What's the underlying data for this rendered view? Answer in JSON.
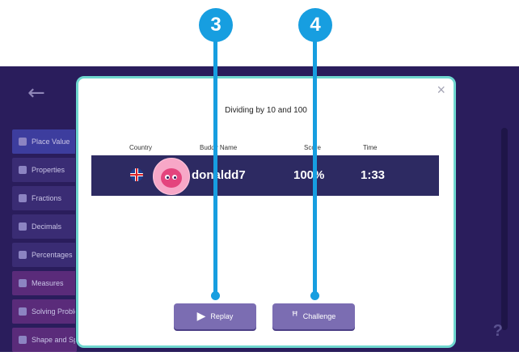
{
  "modal": {
    "title": "Dividing by 10 and 100",
    "close_glyph": "×",
    "columns": {
      "country": "Country",
      "buddy": "Buddy Name",
      "score": "Score",
      "time": "Time"
    },
    "row": {
      "country_icon": "uk-flag-icon",
      "buddy_name": "donaldd7",
      "score": "100%",
      "time": "1:33"
    },
    "buttons": {
      "replay": {
        "label": "Replay",
        "icon": "play-icon",
        "glyph": "▶"
      },
      "challenge": {
        "label": "Challenge",
        "icon": "medal-icon",
        "glyph": "ꟸ"
      }
    }
  },
  "sidebar": {
    "items": [
      {
        "label": "Place Value"
      },
      {
        "label": "Properties"
      },
      {
        "label": "Fractions"
      },
      {
        "label": "Decimals"
      },
      {
        "label": "Percentages"
      },
      {
        "label": "Measures"
      },
      {
        "label": "Solving Problems"
      },
      {
        "label": "Shape and Space"
      }
    ]
  },
  "background": {
    "back_glyph": "←",
    "help_glyph": "?"
  },
  "annotations": [
    {
      "number": "3"
    },
    {
      "number": "4"
    }
  ],
  "colors": {
    "modal_border": "#6fd7cf",
    "row_bg": "#2d2a62",
    "button_bg": "#7b6db2",
    "annotation": "#179ee0",
    "app_bg": "#2a1d5c"
  }
}
